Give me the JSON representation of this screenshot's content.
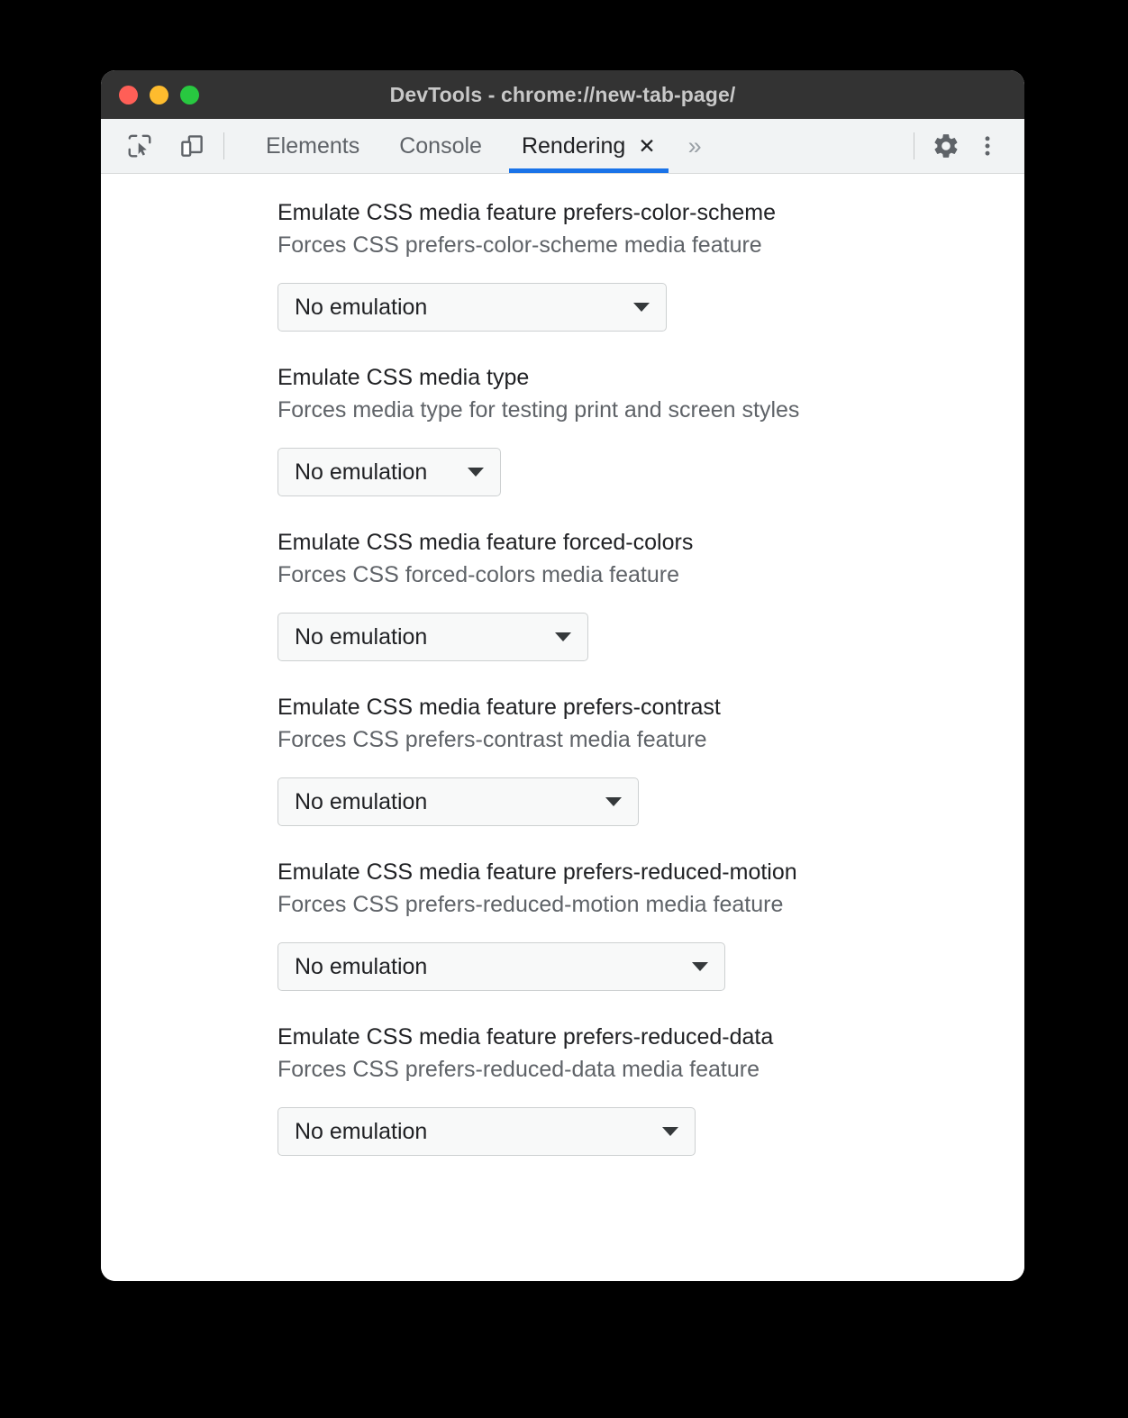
{
  "window": {
    "title": "DevTools - chrome://new-tab-page/",
    "traffic_lights": [
      {
        "name": "close-button",
        "color": "#ff5f57"
      },
      {
        "name": "minimize-button",
        "color": "#febc2e"
      },
      {
        "name": "maximize-button",
        "color": "#28c840"
      }
    ]
  },
  "toolbar": {
    "icons": [
      {
        "name": "inspect-element-icon",
        "label": "Inspect element"
      },
      {
        "name": "device-toolbar-icon",
        "label": "Toggle device toolbar"
      }
    ],
    "tabs": [
      {
        "label": "Elements",
        "active": false,
        "closable": false
      },
      {
        "label": "Console",
        "active": false,
        "closable": false
      },
      {
        "label": "Rendering",
        "active": true,
        "closable": true
      }
    ],
    "close_glyph": "✕",
    "more_tabs_glyph": "»",
    "settings_label": "Settings",
    "menu_label": "Customize and control DevTools",
    "active_tab_accent": "#1a73e8"
  },
  "panel": {
    "settings": [
      {
        "title": "Emulate CSS media feature prefers-color-scheme",
        "description": "Forces CSS prefers-color-scheme media feature",
        "value": "No emulation",
        "select_width": 432
      },
      {
        "title": "Emulate CSS media type",
        "description": "Forces media type for testing print and screen styles",
        "value": "No emulation",
        "select_width": 248
      },
      {
        "title": "Emulate CSS media feature forced-colors",
        "description": "Forces CSS forced-colors media feature",
        "value": "No emulation",
        "select_width": 345
      },
      {
        "title": "Emulate CSS media feature prefers-contrast",
        "description": "Forces CSS prefers-contrast media feature",
        "value": "No emulation",
        "select_width": 401
      },
      {
        "title": "Emulate CSS media feature prefers-reduced-motion",
        "description": "Forces CSS prefers-reduced-motion media feature",
        "value": "No emulation",
        "select_width": 497
      },
      {
        "title": "Emulate CSS media feature prefers-reduced-data",
        "description": "Forces CSS prefers-reduced-data media feature",
        "value": "No emulation",
        "select_width": 464
      }
    ]
  }
}
